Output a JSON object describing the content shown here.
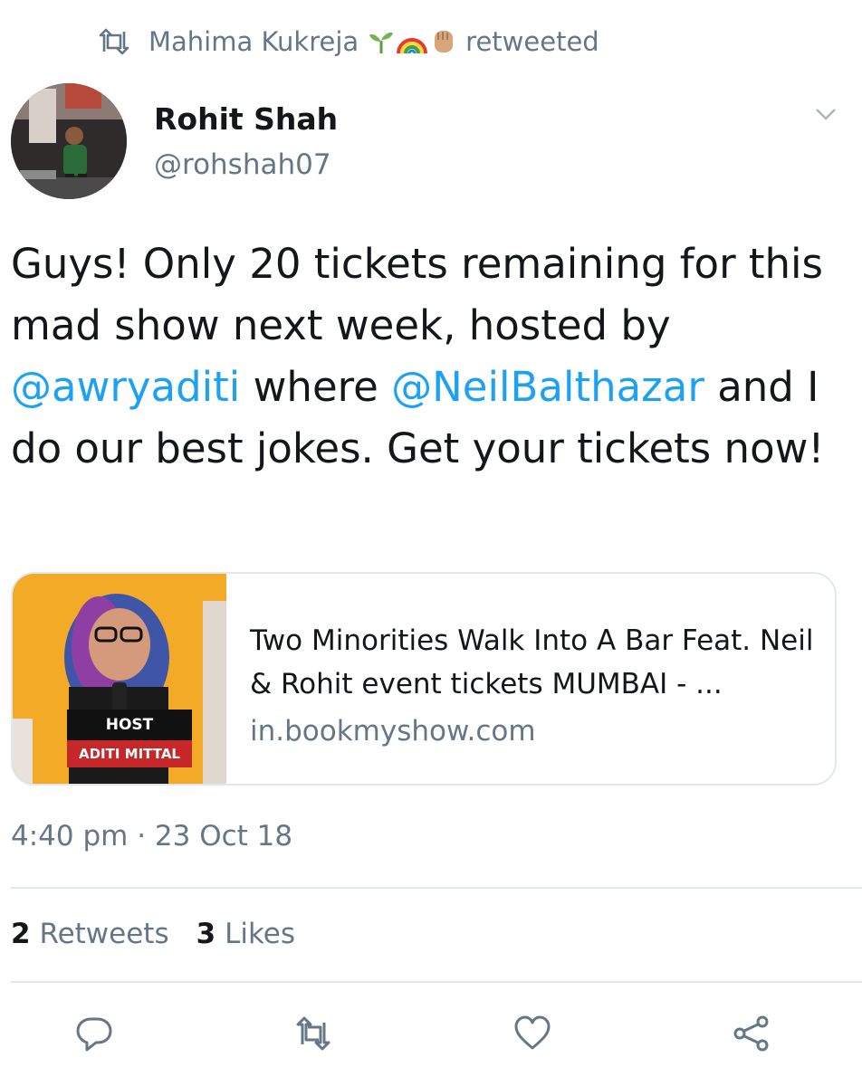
{
  "retweet": {
    "user": "Mahima Kukreja",
    "emojis": [
      "seedling",
      "rainbow",
      "raised-fist"
    ],
    "suffix": "retweeted"
  },
  "author": {
    "name": "Rohit Shah",
    "handle": "@rohshah07"
  },
  "tweet": {
    "text_1": "Guys! Only 20 tickets remaining for this mad show next week, hosted by ",
    "mention_1": "@awryaditi",
    "text_2": " where ",
    "mention_2": "@NeilBalthazar",
    "text_3": " and I do our best jokes. Get your tickets now!"
  },
  "card": {
    "title": "Two Minorities Walk Into A Bar Feat. Neil & Rohit event tickets MUMBAI - ...",
    "domain": "in.bookmyshow.com",
    "badge_top": "HOST",
    "badge_bottom": "ADITI MITTAL"
  },
  "timestamp": "4:40 pm · 23 Oct 18",
  "stats": {
    "retweets_count": "2",
    "retweets_label": "Retweets",
    "likes_count": "3",
    "likes_label": "Likes"
  },
  "icons": {
    "retweet": "retweet-icon",
    "caret": "chevron-down-icon",
    "reply": "reply-icon",
    "retweet_action": "retweet-icon",
    "like": "heart-icon",
    "share": "share-icon"
  },
  "colors": {
    "link": "#1da1f2",
    "secondary_text": "#657786",
    "primary_text": "#14171a",
    "border": "#e1e8ed"
  }
}
